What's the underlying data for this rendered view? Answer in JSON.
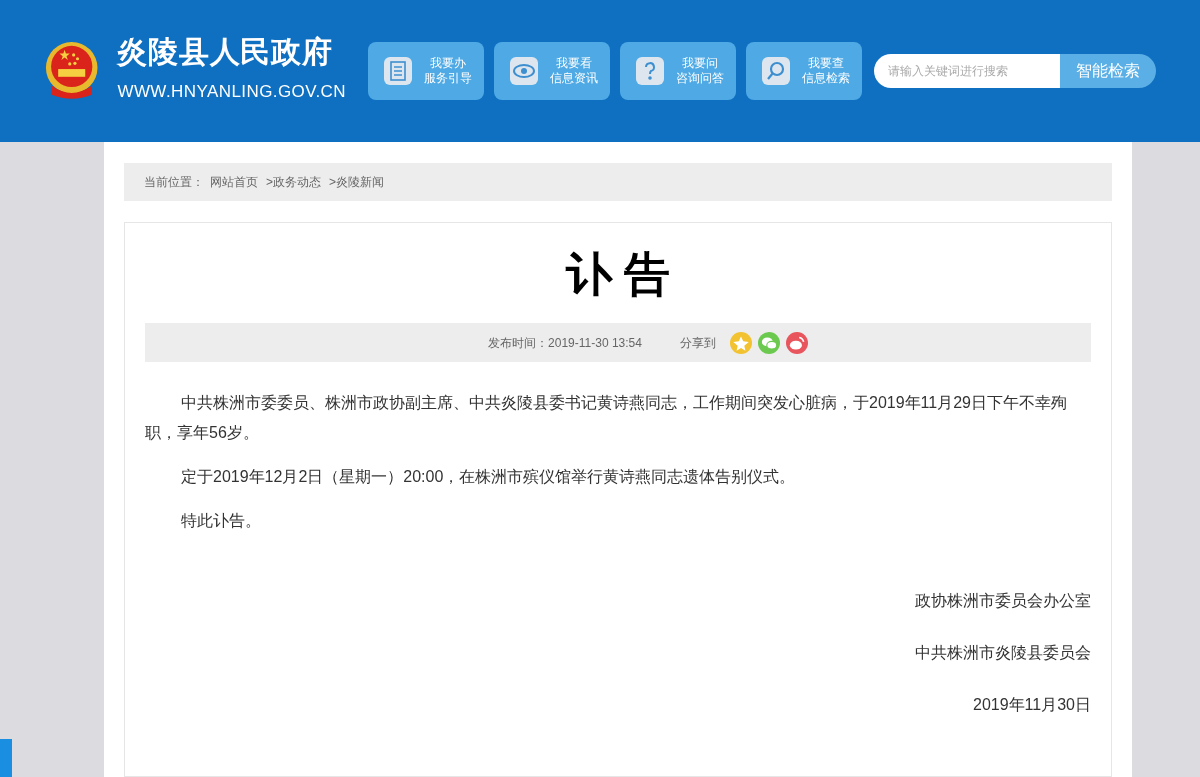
{
  "header": {
    "site_name": "炎陵县人民政府",
    "site_url": "WWW.HNYANLING.GOV.CN",
    "nav": [
      {
        "kind": "document",
        "line1": "我要办",
        "line2": "服务引导"
      },
      {
        "kind": "eye",
        "line1": "我要看",
        "line2": "信息资讯"
      },
      {
        "kind": "question",
        "line1": "我要问",
        "line2": "咨询问答"
      },
      {
        "kind": "search",
        "line1": "我要查",
        "line2": "信息检索"
      }
    ],
    "search": {
      "placeholder": "请输入关键词进行搜索",
      "button": "智能检索"
    }
  },
  "breadcrumb": {
    "label": "当前位置：",
    "items": [
      "网站首页",
      ">政务动态",
      ">炎陵新闻"
    ]
  },
  "article": {
    "title": "讣 告",
    "published": "发布时间：2019-11-30 13:54",
    "share_label": "分享到",
    "share": [
      {
        "kind": "star",
        "color": "#f2c230"
      },
      {
        "kind": "wechat",
        "color": "#6cc94f"
      },
      {
        "kind": "weibo",
        "color": "#e8555d"
      }
    ],
    "paragraphs": [
      "中共株洲市委委员、株洲市政协副主席、中共炎陵县委书记黄诗燕同志，工作期间突发心脏病，于2019年11月29日下午不幸殉职，享年56岁。",
      "定于2019年12月2日（星期一）20:00，在株洲市殡仪馆举行黄诗燕同志遗体告别仪式。",
      "特此讣告。"
    ],
    "signatures": [
      "政协株洲市委员会办公室",
      "中共株洲市炎陵县委员会",
      "2019年11月30日"
    ]
  }
}
